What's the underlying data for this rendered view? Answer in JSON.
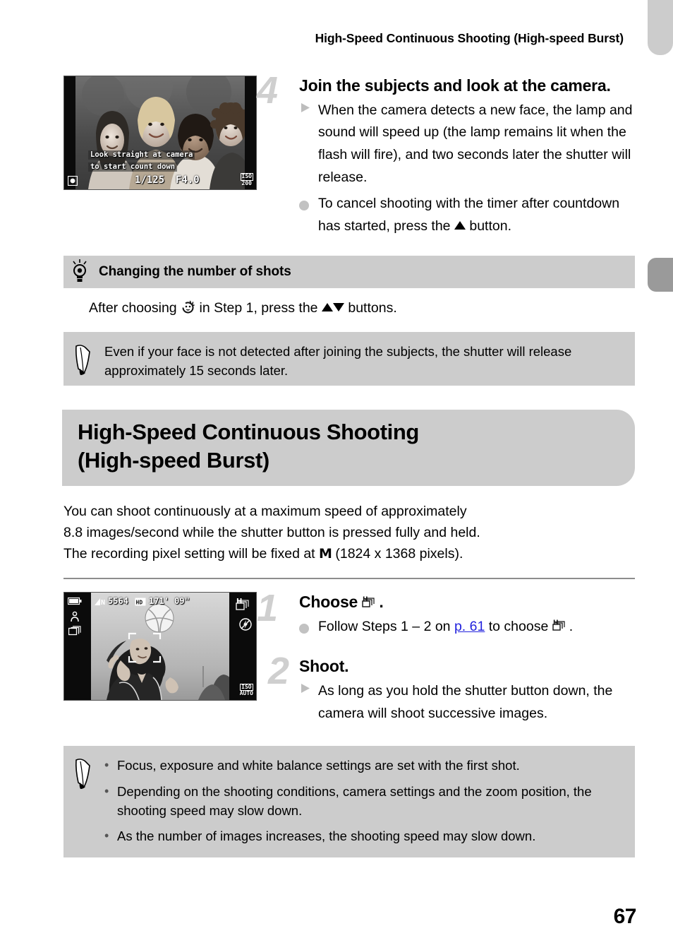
{
  "header": {
    "running_title": "High-Speed Continuous Shooting (High-speed Burst)"
  },
  "page_number": "67",
  "step4": {
    "number": "4",
    "heading": "Join the subjects and look at the camera.",
    "bullets": [
      {
        "mark": "triangle-right",
        "text_before": "When the camera detects a new face, the lamp and sound will speed up (the lamp remains lit when the flash will fire), and two seconds later the shutter will release.",
        "text_after": ""
      },
      {
        "mark": "dot",
        "text_before": "To cancel shooting with the timer after countdown has started, press the ",
        "icon": "up-arrow-button-icon",
        "text_after": " button."
      }
    ],
    "figure": {
      "name": "camera-lcd-face-selftimer",
      "osd_line1": "Look straight at camera",
      "osd_line2": "to start count down",
      "shutter_speed": "1/125",
      "aperture": "F4.0",
      "iso_label": "ISO",
      "iso_value": "200",
      "metering_icon": "metering-icon"
    }
  },
  "tip": {
    "icon": "lightbulb-icon",
    "title": "Changing the number of shots",
    "body_before": "After choosing ",
    "body_icon": "face-selftimer-icon",
    "body_middle": " in Step 1, press the ",
    "body_buttons": "up-down-buttons-icon",
    "body_after": " buttons."
  },
  "note_top": {
    "icon": "pencil-note-icon",
    "text": "Even if your face is not detected after joining the subjects, the shutter will release approximately 15 seconds later."
  },
  "section": {
    "title_line1": "High-Speed Continuous Shooting",
    "title_line2": "(High-speed Burst)"
  },
  "intro": {
    "line1": "You can shoot continuously at a maximum speed of approximately",
    "line2": "8.8 images/second while the shutter button is pressed fully and held.",
    "line3_before": "The recording pixel setting will be fixed at ",
    "line3_icon": "M",
    "line3_after": " (1824 x 1368 pixels)."
  },
  "step1": {
    "number": "1",
    "heading_before": "Choose ",
    "heading_icon": "high-speed-burst-icon",
    "heading_after": ".",
    "bullet": {
      "mark": "dot",
      "text_before": "Follow Steps 1 – 2 on ",
      "link": "p. 61",
      "text_middle": " to choose ",
      "icon": "high-speed-burst-icon",
      "text_after": "."
    },
    "figure": {
      "name": "camera-lcd-burst-mode",
      "quality_icon": "compression-fine-icon",
      "shots_remaining": "5564",
      "movie_icon": "movie-quality-icon",
      "time_remaining": "171' 09\"",
      "battery_icon": "battery-icon",
      "mode_icon": "burst-mode-icon",
      "drive_icon": "drive-mode-icon",
      "burst_icon": "high-speed-burst-icon",
      "flash_icon": "flash-off-icon",
      "iso_label": "ISO",
      "iso_value": "AUTO"
    }
  },
  "step2": {
    "number": "2",
    "heading": "Shoot.",
    "bullet": {
      "mark": "triangle-right",
      "text": "As long as you hold the shutter button down, the camera will shoot successive images."
    }
  },
  "note_bottom": {
    "icon": "pencil-note-icon",
    "bullets": [
      "Focus, exposure and white balance settings are set with the first shot.",
      "Depending on the shooting conditions, camera settings and the zoom position, the shooting speed may slow down.",
      "As the number of images increases, the shooting speed may slow down."
    ]
  },
  "colors": {
    "grey_panel": "#cccccc",
    "edge_tab_dark": "#9a9a9a",
    "step_number": "#cfcfcf",
    "link": "#2222dd"
  }
}
